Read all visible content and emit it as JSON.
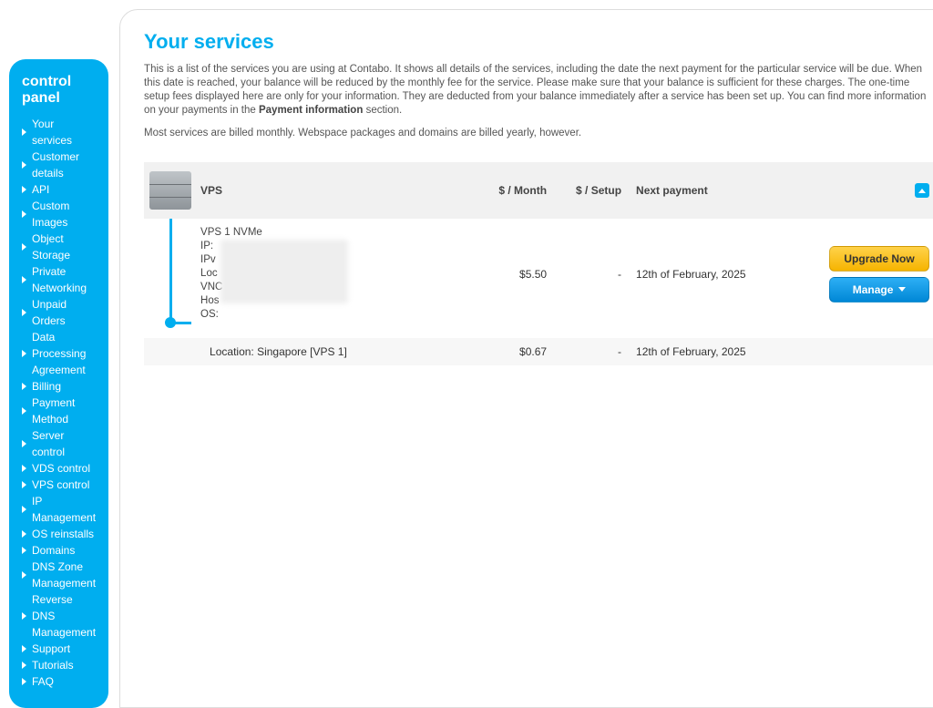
{
  "sidebar": {
    "title": "control panel",
    "items": [
      "Your services",
      "Customer details",
      "API",
      "Custom Images",
      "Object Storage",
      "Private Networking",
      "Unpaid Orders",
      "Data Processing Agreement",
      "Billing",
      "Payment Method",
      "Server control",
      "VDS control",
      "VPS control",
      "IP Management",
      "OS reinstalls",
      "Domains",
      "DNS Zone Management",
      "Reverse DNS Management",
      "Support",
      "Tutorials",
      "FAQ"
    ]
  },
  "page": {
    "title": "Your services",
    "intro1_a": "This is a list of the services you are using at Contabo. It shows all details of the services, including the date the next payment for the particular service will be due. When this date is reached, your balance will be reduced by the monthly fee for the service. Please make sure that your balance is sufficient for these charges. The one-time setup fees displayed here are only for your information. They are deducted from your balance immediately after a service has been set up. You can find more information on your payments in the ",
    "intro1_bold": "Payment information",
    "intro1_b": " section.",
    "intro2": "Most services are billed monthly. Webspace packages and domains are billed yearly, however."
  },
  "table": {
    "headers": {
      "vps": "VPS",
      "month": "$ / Month",
      "setup": "$ / Setup",
      "next": "Next payment"
    },
    "row1": {
      "name": "VPS 1 NVMe",
      "label_ip": "IP:",
      "label_ipv6": "IPv",
      "label_loc": "Loc",
      "label_vnc": "VNC",
      "label_host": "Hos",
      "label_os": "OS:",
      "price_month": "$5.50",
      "price_setup": "-",
      "next_payment": "12th of February, 2025"
    },
    "row2": {
      "name": "Location: Singapore [VPS 1]",
      "price_month": "$0.67",
      "price_setup": "-",
      "next_payment": "12th of February, 2025"
    },
    "buttons": {
      "upgrade": "Upgrade Now",
      "manage": "Manage"
    }
  }
}
